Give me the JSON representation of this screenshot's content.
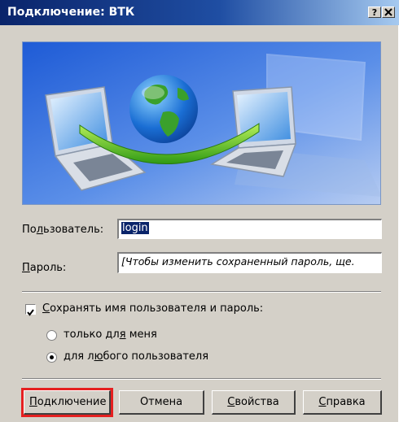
{
  "window": {
    "title": "Подключение: ВТК",
    "help_button": "?",
    "close_button": "X"
  },
  "form": {
    "user_label": "Пользователь:",
    "user_value": "login",
    "password_label": "Пароль:",
    "password_value": "[Чтобы изменить сохраненный пароль, ще."
  },
  "options": {
    "save_label": "Сохранять имя пользователя и пароль:",
    "save_checked": true,
    "radio_only_me": "только для меня",
    "radio_anyone": "для любого пользователя",
    "selected": "anyone"
  },
  "buttons": {
    "connect": "Подключение",
    "cancel": "Отмена",
    "properties": "Свойства",
    "help": "Справка"
  },
  "colors": {
    "title_bar": "#0a246a",
    "dialog_bg": "#d4d0c8",
    "highlight": "#e52020"
  }
}
